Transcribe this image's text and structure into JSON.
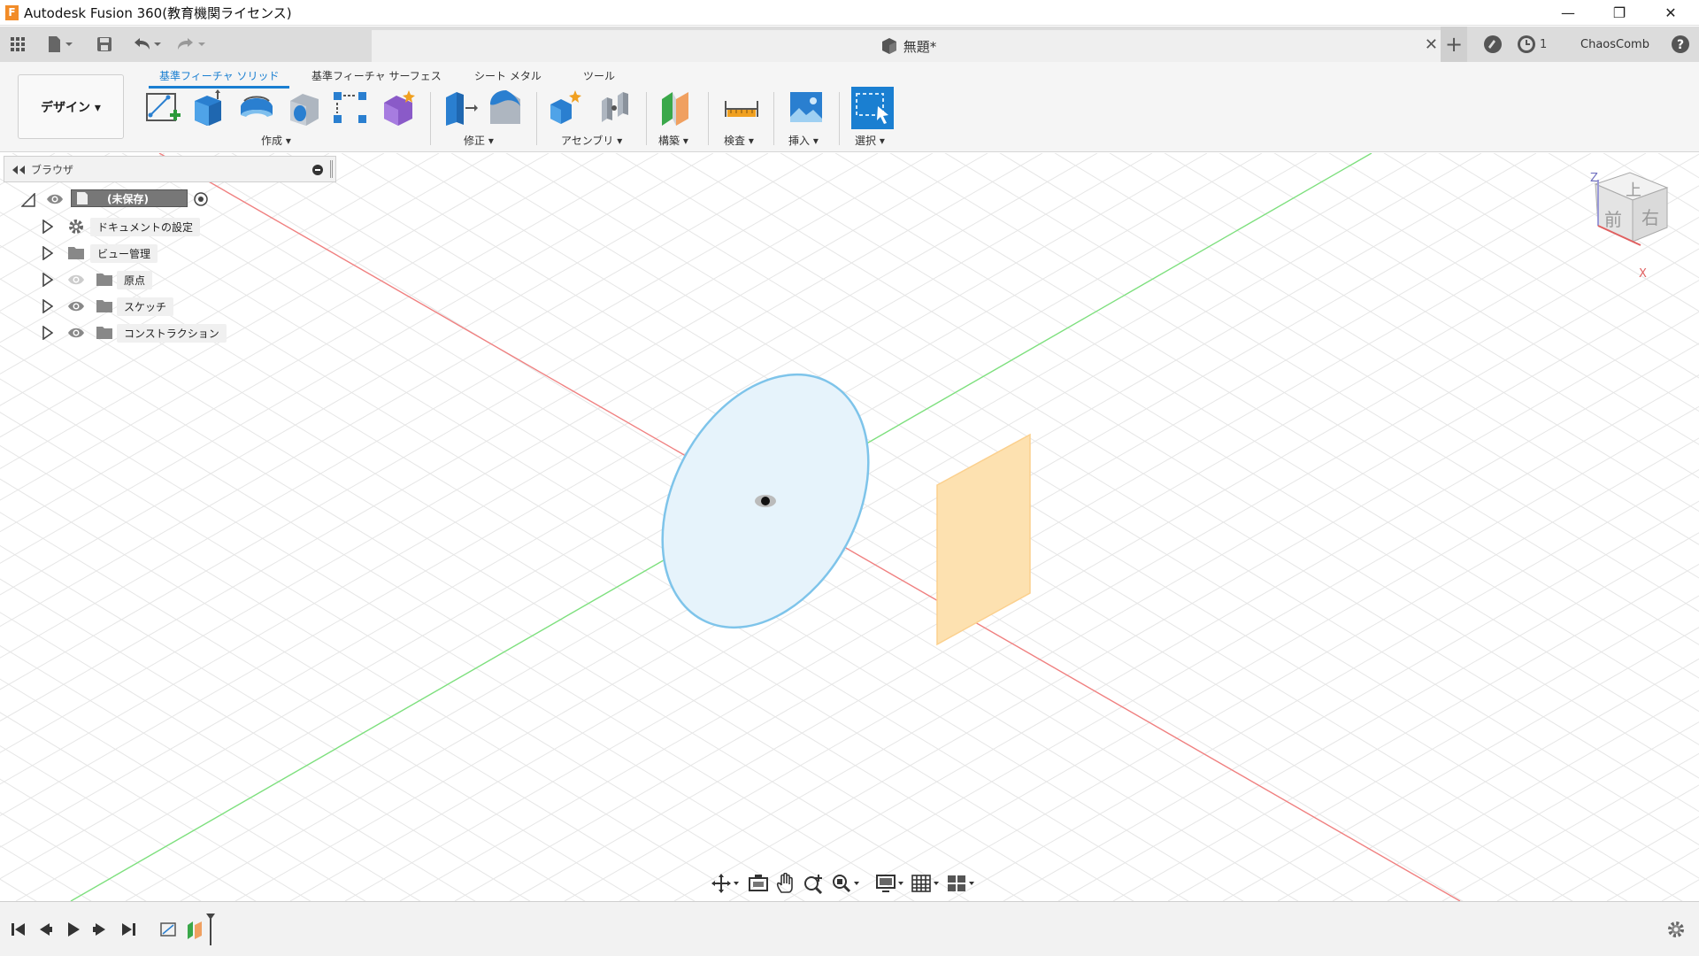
{
  "window": {
    "title": "Autodesk Fusion 360(教育機関ライセンス)",
    "minimize_icon": "minimize-icon",
    "restore_icon": "restore-icon",
    "close_icon": "close-icon"
  },
  "quickbar": {
    "doc_title": "無題*",
    "job_count": "1",
    "user_name": "ChaosComb"
  },
  "ribbon": {
    "workspace_label": "デザイン ▾",
    "tabs": [
      {
        "label": "基準フィーチャ ソリッド",
        "active": true
      },
      {
        "label": "基準フィーチャ サーフェス",
        "active": false
      },
      {
        "label": "シート メタル",
        "active": false
      },
      {
        "label": "ツール",
        "active": false
      }
    ],
    "groups": {
      "create": "作成 ▾",
      "modify": "修正 ▾",
      "assemble": "アセンブリ ▾",
      "construct": "構築 ▾",
      "inspect": "検査 ▾",
      "insert": "挿入 ▾",
      "select": "選択 ▾"
    }
  },
  "browser": {
    "title": "ブラウザ",
    "root_label": "(未保存)",
    "items": [
      {
        "label": "ドキュメントの設定",
        "icon": "gear-icon"
      },
      {
        "label": "ビュー管理",
        "icon": "folder-icon"
      },
      {
        "label": "原点",
        "icon": "folder-icon"
      },
      {
        "label": "スケッチ",
        "icon": "folder-icon"
      },
      {
        "label": "コンストラクション",
        "icon": "folder-icon"
      }
    ]
  },
  "viewcube": {
    "top": "上",
    "front": "前",
    "right": "右",
    "axis_z": "Z",
    "axis_x": "X"
  }
}
